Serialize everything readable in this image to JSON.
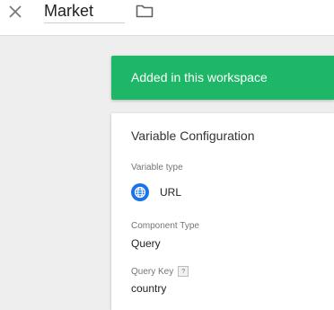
{
  "header": {
    "title_value": "Market"
  },
  "icons": {
    "close": "close-icon",
    "folder": "folder-icon",
    "globe": "globe-icon",
    "help": "help-icon"
  },
  "colors": {
    "banner_background": "#1db767",
    "type_icon_background": "#1a73e8"
  },
  "banner": {
    "text": "Added in this workspace"
  },
  "card": {
    "title": "Variable Configuration",
    "variable_type_label": "Variable type",
    "variable_type_value": "URL",
    "component_type_label": "Component Type",
    "component_type_value": "Query",
    "query_key_label": "Query Key",
    "query_key_help": "?",
    "query_key_value": "country"
  }
}
